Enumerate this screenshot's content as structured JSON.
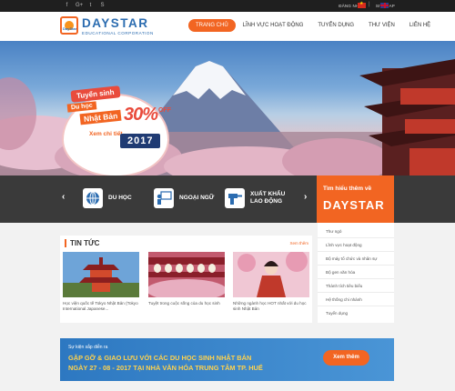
{
  "topbar": {
    "social": [
      "f",
      "G+",
      "t",
      "S"
    ],
    "login": "ĐĂNG NHẬP",
    "sitemap": "SITEMAP",
    "languages": [
      "vn-flag",
      "uk-flag"
    ]
  },
  "logo": {
    "mark": "DayStar",
    "name": "DAYSTAR",
    "subtitle": "EDUCATIONAL CORPORATION"
  },
  "nav": {
    "items": [
      "TRANG CHỦ",
      "LĨNH VỰC HOẠT ĐỘNG",
      "TUYỂN DỤNG",
      "THƯ VIỆN",
      "LIÊN HỆ"
    ],
    "active_index": 0
  },
  "hero": {
    "tag": "Tuyển sinh",
    "line1": "Du học",
    "line2": "Nhật Bản",
    "discount": "30%",
    "off": "OFF",
    "link": "Xem chi tiết",
    "year": "2017",
    "slides": 4,
    "active_slide": 1
  },
  "services": {
    "prev": "‹",
    "next": "›",
    "items": [
      {
        "label": "DU HỌC",
        "icon": "globe-icon"
      },
      {
        "label": "NGOẠI NGỮ",
        "icon": "teacher-icon"
      },
      {
        "label": "XUẤT KHẨU LAO ĐỘNG",
        "label_l1": "XUẤT KHẨU",
        "label_l2": "LAO ĐỘNG",
        "icon": "drill-icon"
      }
    ]
  },
  "cta": {
    "line1": "Tìm hiểu thêm về",
    "line2": "DAYSTAR"
  },
  "news": {
    "title": "TIN TỨC",
    "more": "Xem thêm",
    "cards": [
      {
        "caption": "Học viện quốc tế Tokyo Nhật Bản (Tokyo International Japanese..."
      },
      {
        "caption": "Tuyệt trong cuộc sống của du học sinh"
      },
      {
        "caption": "Những ngành học HOT nhất với du học sinh Nhật Bản"
      }
    ]
  },
  "side_menu": {
    "items": [
      "Thư ngỏ",
      "Lĩnh vực hoạt động",
      "Bộ máy tổ chức và nhân sự",
      "Bộ gen văn hóa",
      "Thành tích tiêu biểu",
      "Hệ thống chi nhánh",
      "Tuyển dụng"
    ]
  },
  "event": {
    "kicker": "Sự kiện sắp diễn ra",
    "line1": "GIAO LƯU VỚI CÁC DU HỌC SINH NHẬT BẢN",
    "line1_full": "GẶP GỠ & GIAO LƯU VỚI CÁC DU HỌC SINH NHẬT BẢN",
    "line2": "NGÀY 27 - 08 - 2017 TẠI NHÀ VĂN HÓA TRUNG TÂM TP. HUẾ",
    "button": "Xem thêm"
  },
  "colors": {
    "accent": "#f26522",
    "brand": "#2b6cb0",
    "dark_bar": "#3a3a3a",
    "event_blue": "#2d78c1",
    "event_text": "#ffd24d"
  }
}
